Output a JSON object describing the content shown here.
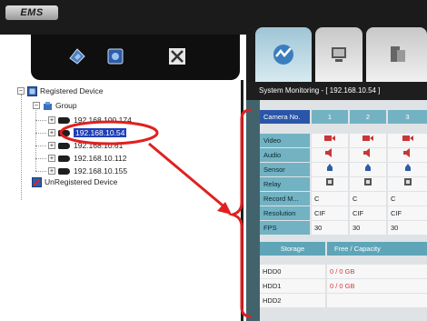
{
  "app": {
    "logo_text": "EMS"
  },
  "toolbar": {
    "buttons": [
      {
        "name": "add-device-icon",
        "color": "#4a7fc1"
      },
      {
        "name": "device-list-icon",
        "color": "#2f5ca8"
      },
      {
        "name": "tools-icon",
        "color": "#333333"
      }
    ]
  },
  "tree": {
    "root_label": "Registered Device",
    "group_label": "Group",
    "devices": [
      "192.168.100.174",
      "192.168.10.54",
      "192.168.10.61",
      "192.168.10.112",
      "192.168.10.155"
    ],
    "selected_index": 1,
    "unregistered_label": "UnRegistered Device"
  },
  "tabs": [
    {
      "name": "monitoring-icon",
      "active": true
    },
    {
      "name": "device-settings-icon",
      "active": false
    },
    {
      "name": "computer-icon",
      "active": false
    }
  ],
  "monitor": {
    "title": "System Monitoring - [ 192.168.10.54 ]",
    "header_label": "Camera No.",
    "camera_numbers": [
      "1",
      "2",
      "3"
    ],
    "rows": [
      {
        "label": "Video",
        "kind": "icon",
        "icon": "video-icon",
        "values": [
          "",
          "",
          ""
        ]
      },
      {
        "label": "Audio",
        "kind": "icon",
        "icon": "audio-icon",
        "values": [
          "",
          "",
          ""
        ]
      },
      {
        "label": "Sensor",
        "kind": "icon",
        "icon": "sensor-icon",
        "values": [
          "",
          "",
          ""
        ]
      },
      {
        "label": "Relay",
        "kind": "icon",
        "icon": "relay-icon",
        "values": [
          "",
          "",
          ""
        ]
      },
      {
        "label": "Record M...",
        "kind": "text",
        "values": [
          "C",
          "C",
          "C"
        ]
      },
      {
        "label": "Resolution",
        "kind": "text",
        "values": [
          "CIF",
          "CIF",
          "CIF"
        ]
      },
      {
        "label": "FPS",
        "kind": "text",
        "values": [
          "30",
          "30",
          "30"
        ]
      }
    ],
    "storage": {
      "label": "Storage",
      "capacity_header": "Free / Capacity",
      "rows": [
        {
          "label": "HDD0",
          "value": "0 / 0 GB"
        },
        {
          "label": "HDD1",
          "value": "0 / 0 GB"
        },
        {
          "label": "HDD2",
          "value": ""
        }
      ]
    }
  },
  "colors": {
    "annotation": "#e02020",
    "selected": "#1e40b8",
    "header": "#2b56a8",
    "label_cell": "#72b2c2"
  }
}
